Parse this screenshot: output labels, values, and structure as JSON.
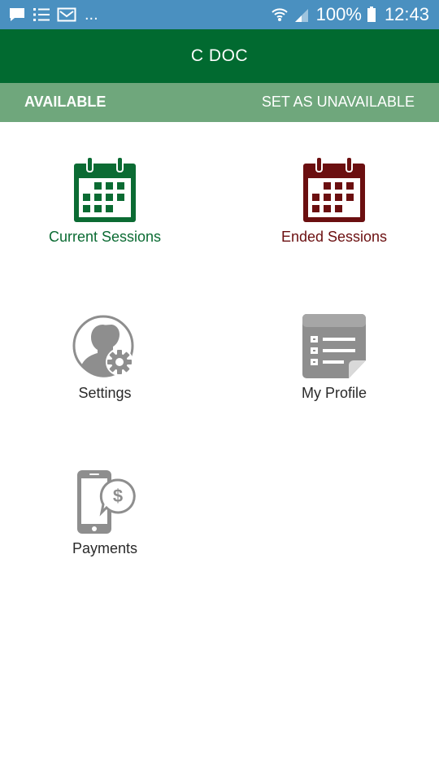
{
  "status_bar": {
    "notification_icons": [
      "message-icon",
      "list-icon",
      "mail-icon"
    ],
    "overflow": "...",
    "battery_percent": "100%",
    "time": "12:43"
  },
  "app_bar": {
    "title": "C DOC"
  },
  "availability": {
    "status": "AVAILABLE",
    "toggle_label": "SET AS UNAVAILABLE"
  },
  "menu": {
    "current_sessions": "Current Sessions",
    "ended_sessions": "Ended Sessions",
    "settings": "Settings",
    "my_profile": "My Profile",
    "payments": "Payments"
  },
  "colors": {
    "status_bar": "#4a90c0",
    "app_bar": "#016a30",
    "availability_bar": "#6fa77c",
    "current_sessions": "#0b6b33",
    "ended_sessions": "#6b0f10",
    "neutral_icon": "#8e8e8e"
  }
}
